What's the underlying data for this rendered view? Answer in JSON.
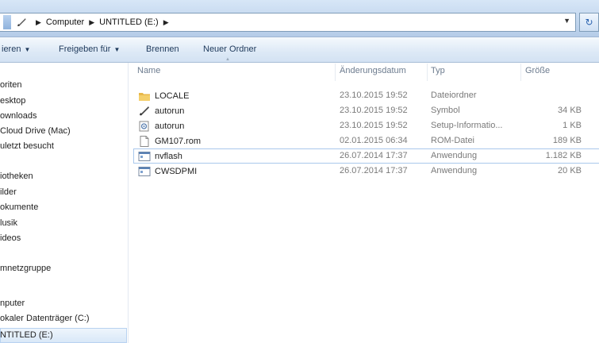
{
  "address_bar": {
    "crumbs": [
      "Computer",
      "UNTITLED (E:)"
    ],
    "refresh_icon": "refresh-icon"
  },
  "toolbar": {
    "organize": "ieren",
    "share": "Freigeben für",
    "burn": "Brennen",
    "new_folder": "Neuer Ordner"
  },
  "nav": {
    "items": [
      "oriten",
      "esktop",
      "ownloads",
      "Cloud Drive (Mac)",
      "uletzt besucht",
      "iotheken",
      "ilder",
      "okumente",
      "lusik",
      "ideos",
      "mnetzgruppe",
      "nputer",
      "okaler Datenträger (C:)",
      "NTITLED (E:)"
    ]
  },
  "columns": {
    "name": "Name",
    "date": "Änderungsdatum",
    "type": "Typ",
    "size": "Größe"
  },
  "files": [
    {
      "name": "LOCALE",
      "date": "23.10.2015 19:52",
      "type": "Dateiordner",
      "size": "",
      "icon": "folder-icon"
    },
    {
      "name": "autorun",
      "date": "23.10.2015 19:52",
      "type": "Symbol",
      "size": "34 KB",
      "icon": "pen-shortcut-icon"
    },
    {
      "name": "autorun",
      "date": "23.10.2015 19:52",
      "type": "Setup-Informatio...",
      "size": "1 KB",
      "icon": "setup-info-icon"
    },
    {
      "name": "GM107.rom",
      "date": "02.01.2015 06:34",
      "type": "ROM-Datei",
      "size": "189 KB",
      "icon": "document-icon"
    },
    {
      "name": "nvflash",
      "date": "26.07.2014 17:37",
      "type": "Anwendung",
      "size": "1.182 KB",
      "icon": "application-icon"
    },
    {
      "name": "CWSDPMI",
      "date": "26.07.2014 17:37",
      "type": "Anwendung",
      "size": "20 KB",
      "icon": "application-icon"
    }
  ],
  "colors": {
    "accent_blue": "#2a62b0",
    "selection_border": "#a9c8ec",
    "folder_yellow": "#e8b84a"
  }
}
